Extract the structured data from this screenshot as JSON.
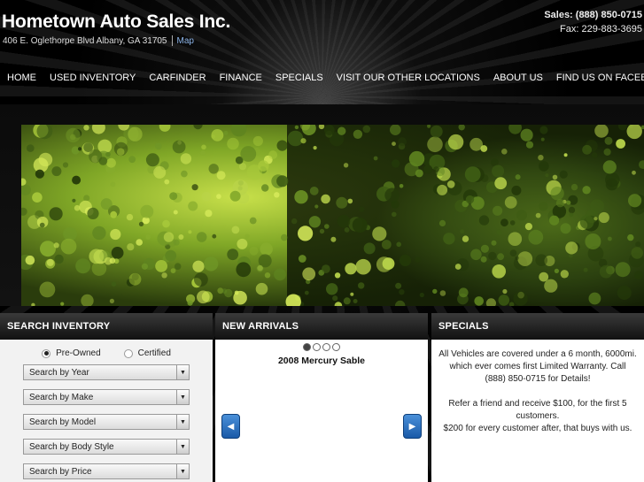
{
  "header": {
    "site_title": "Hometown Auto Sales Inc.",
    "address": "406 E. Oglethorpe Blvd  Albany,  GA  31705",
    "map_link": "Map",
    "sales_phone": "Sales: (888) 850-0715",
    "fax": "Fax: 229-883-3695"
  },
  "nav": {
    "items": [
      {
        "label": "HOME"
      },
      {
        "label": "USED INVENTORY"
      },
      {
        "label": "CARFINDER"
      },
      {
        "label": "FINANCE"
      },
      {
        "label": "SPECIALS"
      },
      {
        "label": "VISIT OUR OTHER LOCATIONS"
      },
      {
        "label": "ABOUT US"
      },
      {
        "label": "FIND US ON FACEBOOK"
      }
    ]
  },
  "search": {
    "title": "SEARCH INVENTORY",
    "radio_preowned": "Pre-Owned",
    "radio_certified": "Certified",
    "selected_radio": "Pre-Owned",
    "selects": [
      {
        "label": "Search by Year"
      },
      {
        "label": "Search by Make"
      },
      {
        "label": "Search by Model"
      },
      {
        "label": "Search by Body Style"
      },
      {
        "label": "Search by Price"
      }
    ]
  },
  "arrivals": {
    "title": "NEW ARRIVALS",
    "vehicle": "2008 Mercury Sable",
    "dot_count": 4,
    "active_dot": 1
  },
  "specials": {
    "title": "SPECIALS",
    "paragraph1": "All Vehicles are covered under a 6 month, 6000mi. which ever comes first Limited Warranty.  Call (888) 850-0715 for Details!",
    "paragraph2": "Refer a friend and receive $100, for the first 5 customers.",
    "paragraph3": "$200 for every customer after, that buys with us."
  },
  "colors": {
    "accent_blue": "#4a90d9",
    "map_link": "#8cb4e8",
    "panel_header": "#1a1a1a"
  },
  "icons": {
    "select_arrow": "triangle-down-icon",
    "prev": "chevron-left-icon",
    "next": "chevron-right-icon"
  }
}
